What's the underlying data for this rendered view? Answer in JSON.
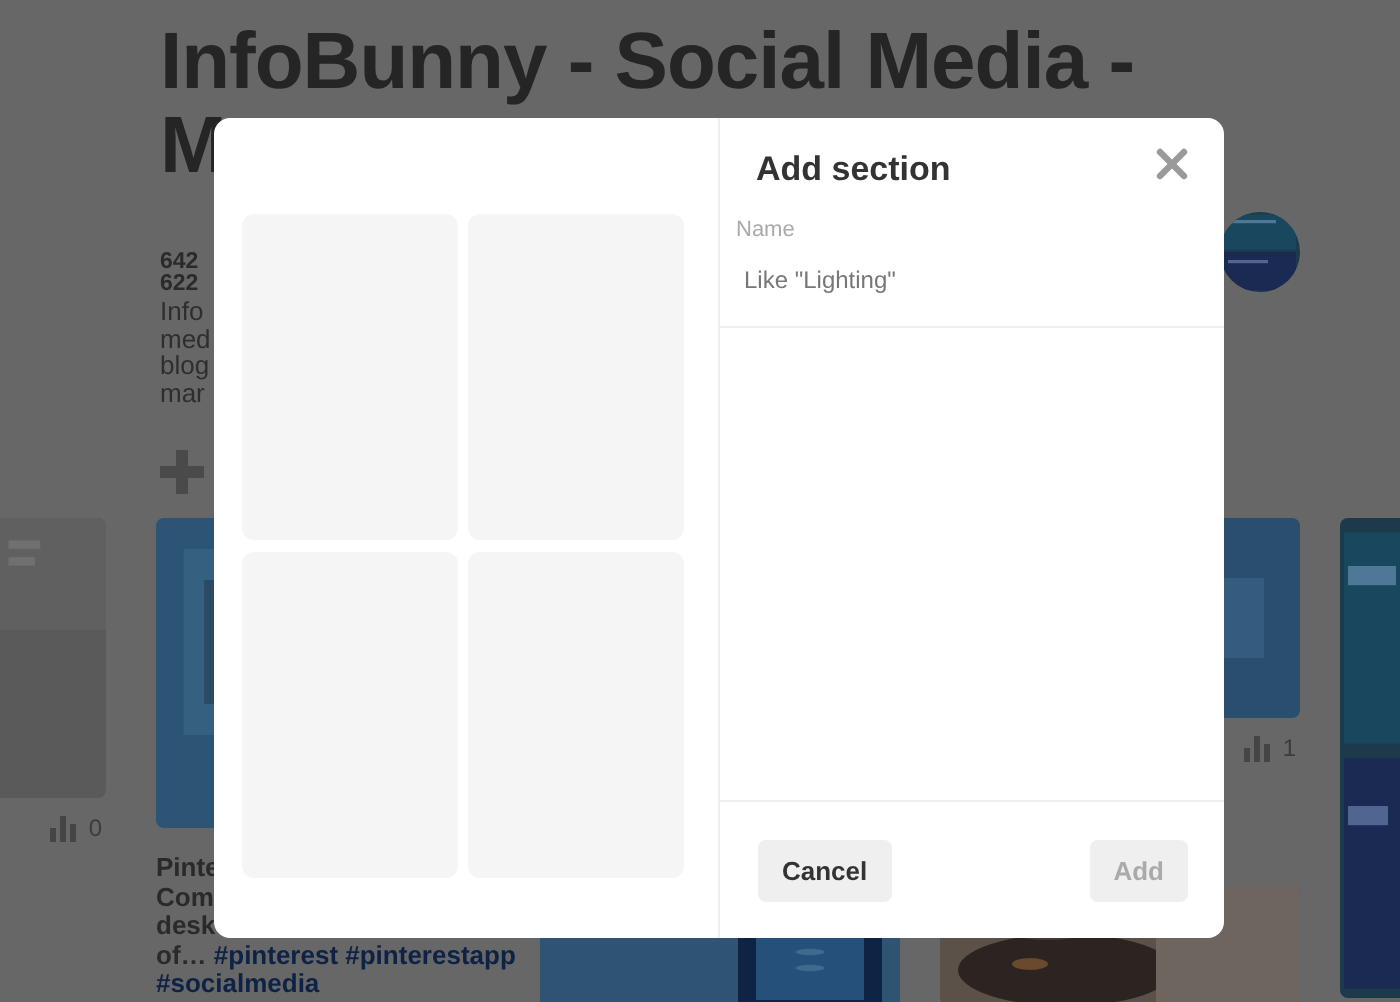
{
  "board": {
    "title_lines": [
      "InfoBunny - Social Media -",
      "M"
    ],
    "stats": [
      {
        "count": "642"
      },
      {
        "count": "622"
      }
    ],
    "description_lines": [
      "Info",
      "med",
      "blog",
      "mar"
    ]
  },
  "columns": [
    [
      {
        "kind": "picture"
      },
      {
        "kind": "count",
        "text": "0"
      }
    ],
    [
      {
        "kind": "picture"
      },
      {
        "kind": "caption",
        "lines": [
          [
            {
              "kind": "plain",
              "text": "Pinte"
            }
          ],
          [
            {
              "kind": "plain",
              "text": "Com"
            }
          ],
          [
            {
              "kind": "plain",
              "text": "desk"
            }
          ],
          [
            {
              "kind": "plain",
              "text": "of…"
            },
            {
              "kind": "tag",
              "text": "#pinterest #pinterestapp"
            }
          ],
          [
            {
              "kind": "tag",
              "text": "#socialmedia"
            }
          ]
        ]
      }
    ],
    [
      {
        "kind": "picture"
      }
    ],
    [
      {
        "kind": "picture"
      },
      {
        "kind": "count",
        "text": "1"
      },
      {
        "kind": "picture"
      }
    ],
    [
      {
        "kind": "picture"
      }
    ]
  ],
  "modal": {
    "title": "Add section",
    "field": {
      "label": "Name",
      "placeholder": "Like \"Lighting\""
    },
    "preview_tiles": [
      {
        "kind": "placeholder"
      },
      {
        "kind": "placeholder"
      },
      {
        "kind": "placeholder"
      },
      {
        "kind": "placeholder"
      }
    ],
    "buttons": [
      {
        "label": "Cancel",
        "disabled": false
      },
      {
        "label": "Add",
        "disabled": true
      }
    ]
  }
}
